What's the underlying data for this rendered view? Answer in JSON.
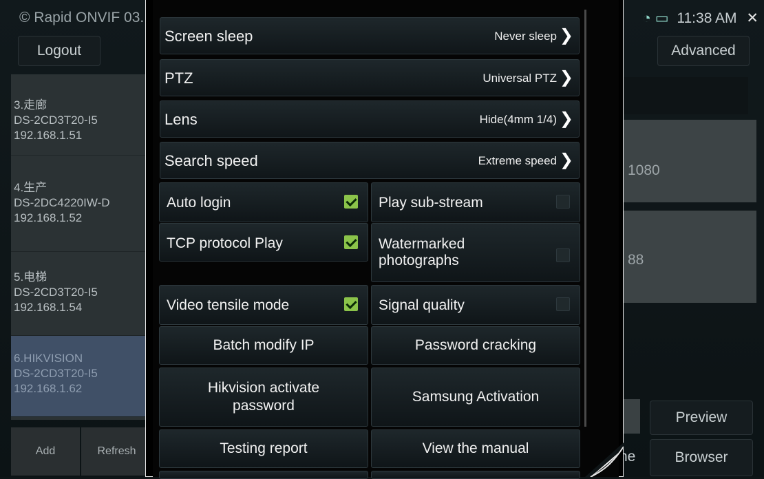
{
  "statusbar": {
    "app_title": "© Rapid ONVIF 03.",
    "time": "11:38 AM",
    "close_glyph": "✕"
  },
  "background": {
    "logout_label": "Logout",
    "advanced_label": "Advanced",
    "devices": [
      {
        "title": "3.走廊",
        "model": "DS-2CD3T20-I5",
        "ip": "192.168.1.51"
      },
      {
        "title": "4.生产",
        "model": "DS-2DC4220IW-D",
        "ip": "192.168.1.52"
      },
      {
        "title": "5.电梯",
        "model": "DS-2CD3T20-I5",
        "ip": "192.168.1.54"
      },
      {
        "title": "6.HIKVISION",
        "model": "DS-2CD3T20-I5",
        "ip": "192.168.1.62"
      }
    ],
    "add_label": "Add",
    "refresh_label": "Refresh",
    "right_text_1": "1080",
    "right_text_2": "88",
    "preview_label": "Preview",
    "browser_label": "Browser",
    "partial_label": "ne"
  },
  "settings": {
    "rows": [
      {
        "label": "Screen sleep",
        "value": "Never sleep"
      },
      {
        "label": "PTZ",
        "value": "Universal PTZ"
      },
      {
        "label": "Lens",
        "value": "Hide(4mm 1/4)"
      },
      {
        "label": "Search speed",
        "value": "Extreme speed"
      }
    ],
    "toggles": [
      {
        "label": "Auto login",
        "checked": true
      },
      {
        "label": "Play sub-stream",
        "checked": false
      },
      {
        "label": "TCP protocol Play",
        "checked": true
      },
      {
        "label": "Watermarked photographs",
        "checked": false
      },
      {
        "label": "Video tensile mode",
        "checked": true
      },
      {
        "label": "Signal quality",
        "checked": false
      }
    ],
    "buttons": [
      {
        "label": "Batch modify IP"
      },
      {
        "label": "Password cracking"
      },
      {
        "label": "Hikvision activate password"
      },
      {
        "label": "Samsung Activation"
      },
      {
        "label": "Testing report"
      },
      {
        "label": "View the manual"
      }
    ]
  },
  "colors": {
    "checkbox_on": "#8bc34a",
    "selected_device": "#405067"
  }
}
